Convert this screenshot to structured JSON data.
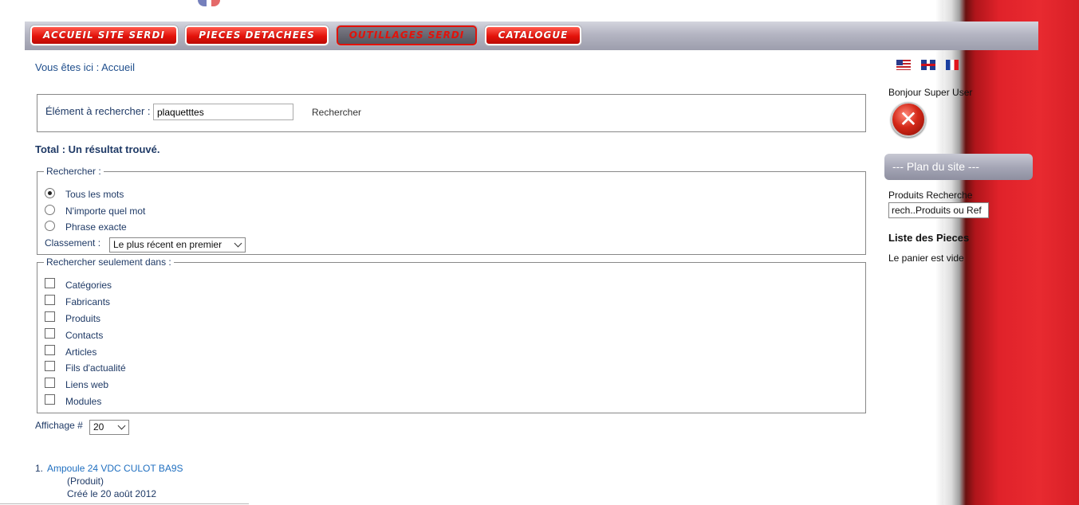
{
  "nav": {
    "items": [
      {
        "label": "ACCUEIL SITE SERDI",
        "active": false
      },
      {
        "label": "PIECES DETACHEES",
        "active": false
      },
      {
        "label": "OUTILLAGES SERDI",
        "active": true
      },
      {
        "label": "CATALOGUE",
        "active": false
      }
    ]
  },
  "breadcrumb": "Vous êtes ici : Accueil",
  "search": {
    "label": "Élément à rechercher :",
    "value": "plaquetttes",
    "button": "Rechercher"
  },
  "total": "Total : Un résultat trouvé.",
  "search_options": {
    "legend": "Rechercher :",
    "radios": [
      {
        "label": "Tous les mots",
        "checked": true
      },
      {
        "label": "N'importe quel mot",
        "checked": false
      },
      {
        "label": "Phrase exacte",
        "checked": false
      }
    ],
    "sort_label": "Classement :",
    "sort_value": "Le plus récent en premier"
  },
  "areas": {
    "legend": "Rechercher seulement dans :",
    "items": [
      "Catégories",
      "Fabricants",
      "Produits",
      "Contacts",
      "Articles",
      "Fils d'actualité",
      "Liens web",
      "Modules"
    ]
  },
  "display": {
    "label": "Affichage #",
    "value": "20"
  },
  "results": [
    {
      "number": "1.",
      "title": "Ampoule 24 VDC CULOT BA9S",
      "type": "(Produit)",
      "date": "Créé le 20 août 2012"
    }
  ],
  "sidebar": {
    "flags": [
      "us-flag-icon",
      "uk-flag-icon",
      "fr-flag-icon"
    ],
    "greeting": "Bonjour  Super User",
    "logout_icon": "close-x-icon",
    "plan_label": "--- Plan du site ---",
    "products_label": "Produits Recherche",
    "products_placeholder": "rech..Produits ou Ref",
    "list_title": "Liste des Pieces",
    "cart_status": "Le panier est vide"
  },
  "colors": {
    "accent_red": "#e3120a",
    "nav_gray": "#b4b5c2",
    "link_blue": "#1f6fc0",
    "text_navy": "#1f3a66"
  }
}
